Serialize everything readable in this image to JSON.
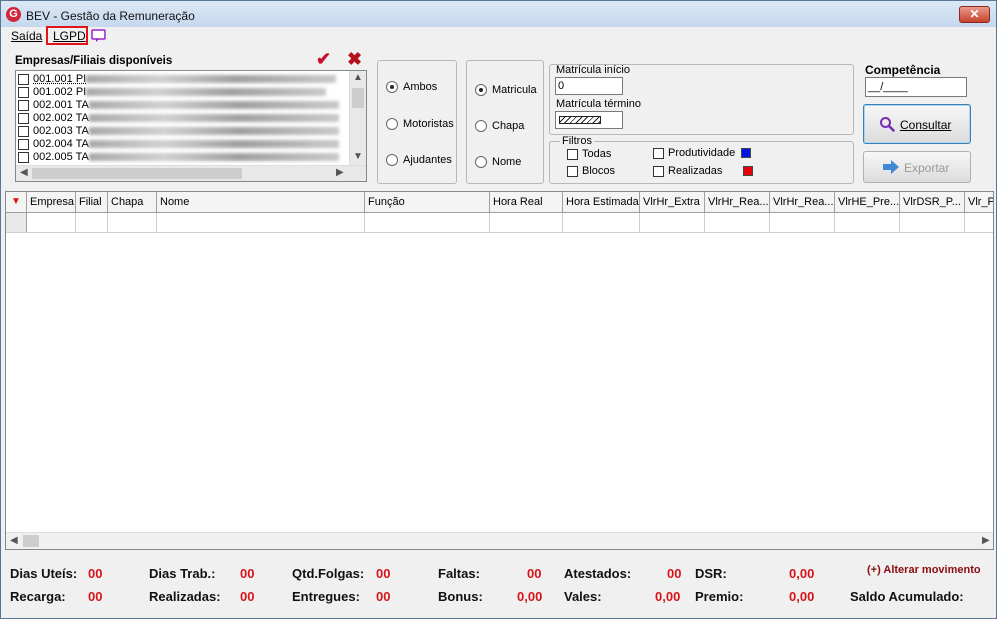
{
  "window": {
    "title": "BEV - Gestão da Remuneração",
    "logo_letter": "G",
    "close_label": "✕"
  },
  "menu": {
    "saida": "Saída",
    "lgpd": "LGPD",
    "chat_icon": "chat-monitor-icon",
    "highlight_color": "#e0151b"
  },
  "empresas": {
    "label": "Empresas/Filiais disponíveis",
    "confirm_icon": "✔",
    "cancel_icon": "✖",
    "items": [
      {
        "code": "001.001 PI"
      },
      {
        "code": "001.002 PI"
      },
      {
        "code": "002.001 TA"
      },
      {
        "code": "002.002 TA"
      },
      {
        "code": "002.003 TA"
      },
      {
        "code": "002.004 TA"
      },
      {
        "code": "002.005 TA"
      }
    ]
  },
  "tipo": {
    "options": [
      "Ambos",
      "Motoristas",
      "Ajudantes"
    ],
    "selected": "Ambos"
  },
  "ordem": {
    "options": [
      "Matricula",
      "Chapa",
      "Nome"
    ],
    "selected": "Matricula"
  },
  "matricula": {
    "inicio_label": "Matrícula início",
    "inicio_value": "0",
    "termino_label": "Matrícula término"
  },
  "filtros": {
    "label": "Filtros",
    "todas": "Todas",
    "blocos": "Blocos",
    "produtividade": "Produtividade",
    "realizadas": "Realizadas",
    "produtividade_color": "#0016e8",
    "realizadas_color": "#e8000b"
  },
  "competencia": {
    "label": "Competência",
    "value": "__/____"
  },
  "buttons": {
    "consultar": "Consultar",
    "exportar": "Exportar"
  },
  "grid": {
    "columns": [
      "Empresa",
      "Filial",
      "Chapa",
      "Nome",
      "Função",
      "Hora Real",
      "Hora Estimada",
      "VlrHr_Extra",
      "VlrHr_Rea...",
      "VlrHr_Rea...",
      "VlrHE_Pre...",
      "VlrDSR_P...",
      "Vlr_Pl"
    ]
  },
  "footer": {
    "dias_uteis_label": "Dias Uteís:",
    "dias_uteis": "00",
    "dias_trab_label": "Dias Trab.:",
    "dias_trab": "00",
    "qtd_folgas_label": "Qtd.Folgas:",
    "qtd_folgas": "00",
    "faltas_label": "Faltas:",
    "faltas": "00",
    "atestados_label": "Atestados:",
    "atestados": "00",
    "dsr_label": "DSR:",
    "dsr": "0,00",
    "recarga_label": "Recarga:",
    "recarga": "00",
    "realizadas_label": "Realizadas:",
    "realizadas": "00",
    "entregues_label": "Entregues:",
    "entregues": "00",
    "bonus_label": "Bonus:",
    "bonus": "0,00",
    "vales_label": "Vales:",
    "vales": "0,00",
    "premio_label": "Premio:",
    "premio": "0,00",
    "saldo_label": "Saldo Acumulado:",
    "alterar_movimento": "(+) Alterar movimento"
  }
}
